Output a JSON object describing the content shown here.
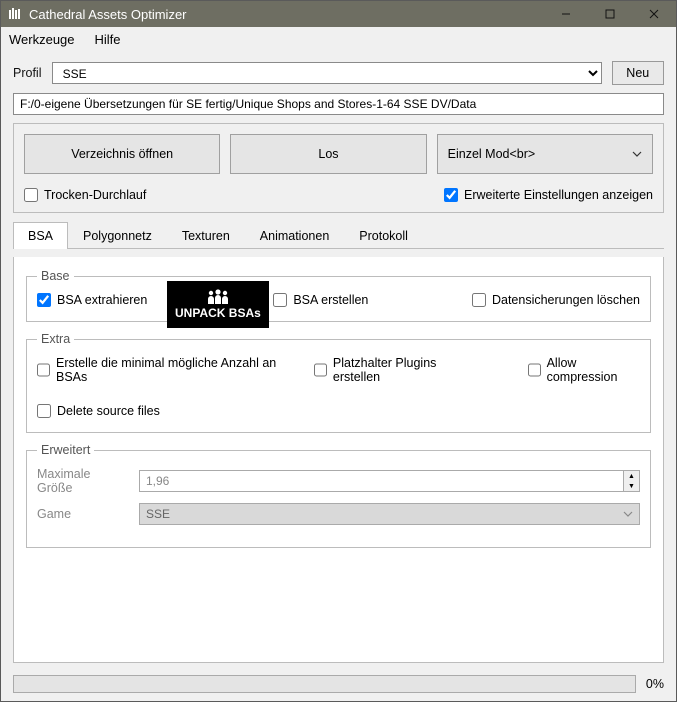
{
  "title": "Cathedral Assets Optimizer",
  "menu": {
    "tools": "Werkzeuge",
    "help": "Hilfe"
  },
  "profile": {
    "label": "Profil",
    "value": "SSE",
    "new_btn": "Neu"
  },
  "path": "F:/0-eigene Übersetzungen für SE fertig/Unique Shops and Stores-1-64 SSE DV/Data",
  "actions": {
    "open_dir": "Verzeichnis öffnen",
    "go": "Los",
    "mode": "Einzel Mod<br>"
  },
  "flags": {
    "dry_run": "Trocken-Durchlauf",
    "advanced": "Erweiterte Einstellungen anzeigen"
  },
  "tabs": {
    "bsa": "BSA",
    "mesh": "Polygonnetz",
    "tex": "Texturen",
    "anim": "Animationen",
    "log": "Protokoll"
  },
  "base": {
    "legend": "Base",
    "extract": "BSA extrahieren",
    "create": "BSA erstellen",
    "delete_backups": "Datensicherungen löschen",
    "tooltip": "UNPACK BSAs"
  },
  "extra": {
    "legend": "Extra",
    "min_bsa": "Erstelle die minimal mögliche Anzahl an BSAs",
    "dummy": "Platzhalter Plugins erstellen",
    "allow_comp": "Allow compression",
    "delete_src": "Delete source files"
  },
  "advanced_box": {
    "legend": "Erweitert",
    "max_size": "Maximale Größe",
    "max_size_val": "1,96",
    "game": "Game",
    "game_val": "SSE"
  },
  "progress": "0%"
}
